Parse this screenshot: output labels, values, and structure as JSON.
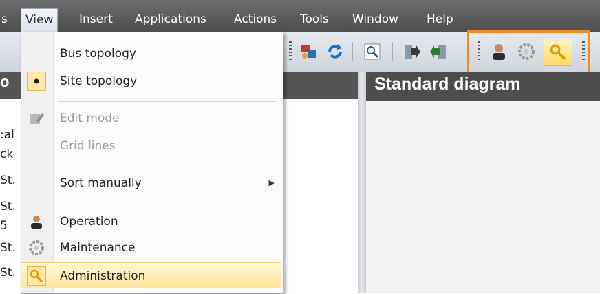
{
  "menubar": {
    "items": [
      {
        "label": "View",
        "active": true
      },
      {
        "label": "Insert"
      },
      {
        "label": "Applications"
      },
      {
        "label": "Actions"
      },
      {
        "label": "Tools"
      },
      {
        "label": "Window"
      },
      {
        "label": "Help"
      }
    ],
    "cut_item": "s"
  },
  "toolbar": {
    "icons": [
      "network-icon",
      "refresh-icon",
      "zoom-icon",
      "export-icon",
      "import-icon",
      "operation-mode-icon",
      "maintenance-mode-icon",
      "administration-mode-icon"
    ],
    "highlight_color": "#f08a24"
  },
  "left_panel": {
    "header_fragment": "o",
    "tree_fragments": [
      ":al",
      "ck",
      "St.",
      "St.",
      "5",
      "St.",
      "St."
    ]
  },
  "right_panel": {
    "title": "Standard diagram"
  },
  "view_menu": {
    "items": [
      {
        "label": "Bus topology",
        "icon": null,
        "state": "normal"
      },
      {
        "label": "Site topology",
        "icon": "radio-dot-icon",
        "state": "checked"
      },
      {
        "label": "Edit mode",
        "icon": "edit-icon",
        "state": "disabled"
      },
      {
        "label": "Grid lines",
        "icon": null,
        "state": "disabled"
      },
      {
        "label": "Sort manually",
        "icon": null,
        "state": "normal",
        "submenu": true
      },
      {
        "label": "Operation",
        "icon": "person-icon",
        "state": "normal"
      },
      {
        "label": "Maintenance",
        "icon": "gear-icon",
        "state": "normal"
      },
      {
        "label": "Administration",
        "icon": "key-icon",
        "state": "hover"
      }
    ]
  }
}
